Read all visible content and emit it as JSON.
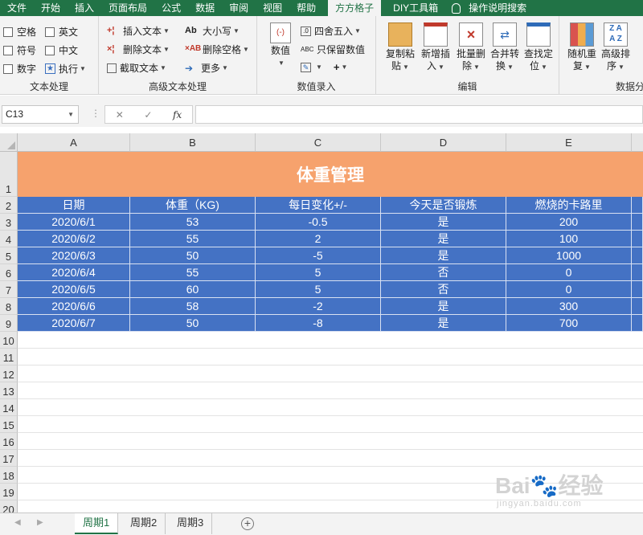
{
  "menu": {
    "tabs": [
      "文件",
      "开始",
      "插入",
      "页面布局",
      "公式",
      "数据",
      "审阅",
      "视图",
      "帮助",
      "方方格子",
      "DIY工具箱",
      "操作说明搜索"
    ],
    "active": "方方格子"
  },
  "ribbon": {
    "text_proc": {
      "checks": [
        "空格",
        "英文",
        "符号",
        "中文",
        "数字",
        "执行"
      ],
      "group_name": "文本处理"
    },
    "adv_text": {
      "left": [
        "插入文本",
        "删除文本",
        "截取文本"
      ],
      "right": [
        "大小写",
        "删除空格",
        "更多"
      ],
      "group_name": "高级文本处理"
    },
    "num_entry": {
      "big": "数值",
      "items": [
        "四舍五入",
        "只保留数值"
      ],
      "group_name": "数值录入"
    },
    "edit": {
      "buttons": [
        [
          "复制粘",
          "贴"
        ],
        [
          "新增插",
          "入"
        ],
        [
          "批量删",
          "除"
        ],
        [
          "合并转",
          "换"
        ],
        [
          "查找定",
          "位"
        ]
      ],
      "group_name": "编辑"
    },
    "data": {
      "buttons": [
        [
          "随机重",
          "复"
        ],
        [
          "高级排",
          "序"
        ]
      ],
      "group_name": "数据分"
    }
  },
  "formula_bar": {
    "name_box": "C13",
    "fx": "fx",
    "formula": ""
  },
  "columns": [
    "A",
    "B",
    "C",
    "D",
    "E"
  ],
  "row_numbers": [
    "1",
    "2",
    "3",
    "4",
    "5",
    "6",
    "7",
    "8",
    "9",
    "10",
    "11",
    "12",
    "13",
    "14",
    "15",
    "16",
    "17",
    "18",
    "19",
    "20"
  ],
  "sheet": {
    "title": "体重管理",
    "headers": [
      "日期",
      "体重（KG)",
      "每日变化+/-",
      "今天是否锻炼",
      "燃烧的卡路里"
    ],
    "rows": [
      [
        "2020/6/1",
        "53",
        "-0.5",
        "是",
        "200"
      ],
      [
        "2020/6/2",
        "55",
        "2",
        "是",
        "100"
      ],
      [
        "2020/6/3",
        "50",
        "-5",
        "是",
        "1000"
      ],
      [
        "2020/6/4",
        "55",
        "5",
        "否",
        "0"
      ],
      [
        "2020/6/5",
        "60",
        "5",
        "否",
        "0"
      ],
      [
        "2020/6/6",
        "58",
        "-2",
        "是",
        "300"
      ],
      [
        "2020/6/7",
        "50",
        "-8",
        "是",
        "700"
      ]
    ]
  },
  "sheet_tabs": [
    "周期1",
    "周期2",
    "周期3"
  ],
  "active_sheet": "周期1",
  "watermark": {
    "main": "Bai经验",
    "sub": "jingyan.baidu.com"
  }
}
